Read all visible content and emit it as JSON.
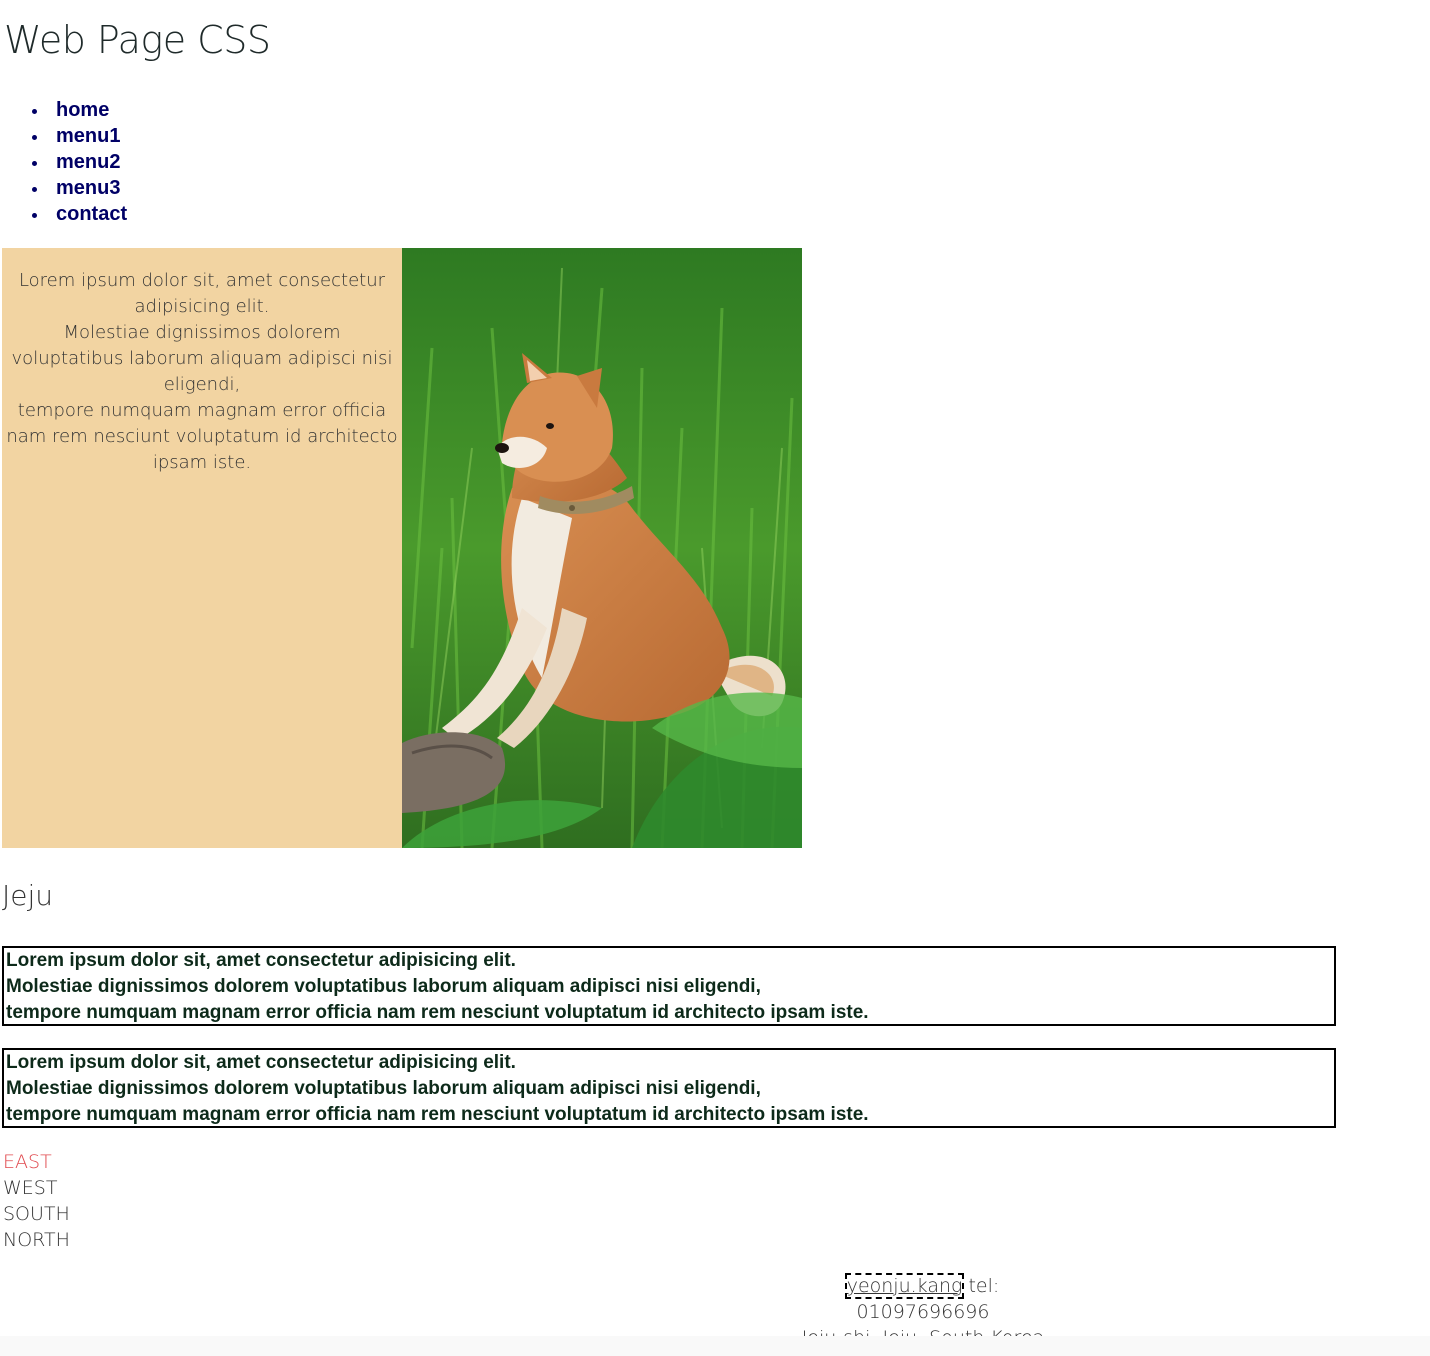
{
  "header": {
    "title": "Web Page CSS"
  },
  "nav": {
    "items": [
      {
        "label": "home"
      },
      {
        "label": "menu1"
      },
      {
        "label": "menu2"
      },
      {
        "label": "menu3"
      },
      {
        "label": "contact"
      }
    ]
  },
  "hero": {
    "text": {
      "line1": "Lorem ipsum dolor sit, amet consectetur adipisicing elit.",
      "line2": "Molestiae dignissimos dolorem voluptatibus laborum aliquam adipisci nisi eligendi,",
      "line3": "tempore numquam magnam error officia nam rem nesciunt voluptatum id architecto ipsam iste."
    },
    "image_icon": "shiba-dog-photo"
  },
  "section": {
    "title": "Jeju",
    "box1": {
      "line1": "Lorem ipsum dolor sit, amet consectetur adipisicing elit.",
      "line2": "Molestiae dignissimos dolorem voluptatibus laborum aliquam adipisci nisi eligendi,",
      "line3": "tempore numquam magnam error officia nam rem nesciunt voluptatum id architecto ipsam iste."
    },
    "box2": {
      "line1": "Lorem ipsum dolor sit, amet consectetur adipisicing elit.",
      "line2": "Molestiae dignissimos dolorem voluptatibus laborum aliquam adipisci nisi eligendi,",
      "line3": "tempore numquam magnam error officia nam rem nesciunt voluptatum id architecto ipsam iste."
    }
  },
  "directions": {
    "items": [
      {
        "label": "EAST",
        "active": true
      },
      {
        "label": "WEST",
        "active": false
      },
      {
        "label": "SOUTH",
        "active": false
      },
      {
        "label": "NORTH",
        "active": false
      }
    ],
    "active_color": "#e0484d"
  },
  "footer": {
    "author": "yeonju.kang",
    "tel": "tel: 01097696696",
    "address": "Jeju-shi, Jeju, South Korea"
  },
  "colors": {
    "nav_link": "#000066",
    "hero_bg": "#f2d4a2",
    "box_text": "#0d2a1a"
  }
}
